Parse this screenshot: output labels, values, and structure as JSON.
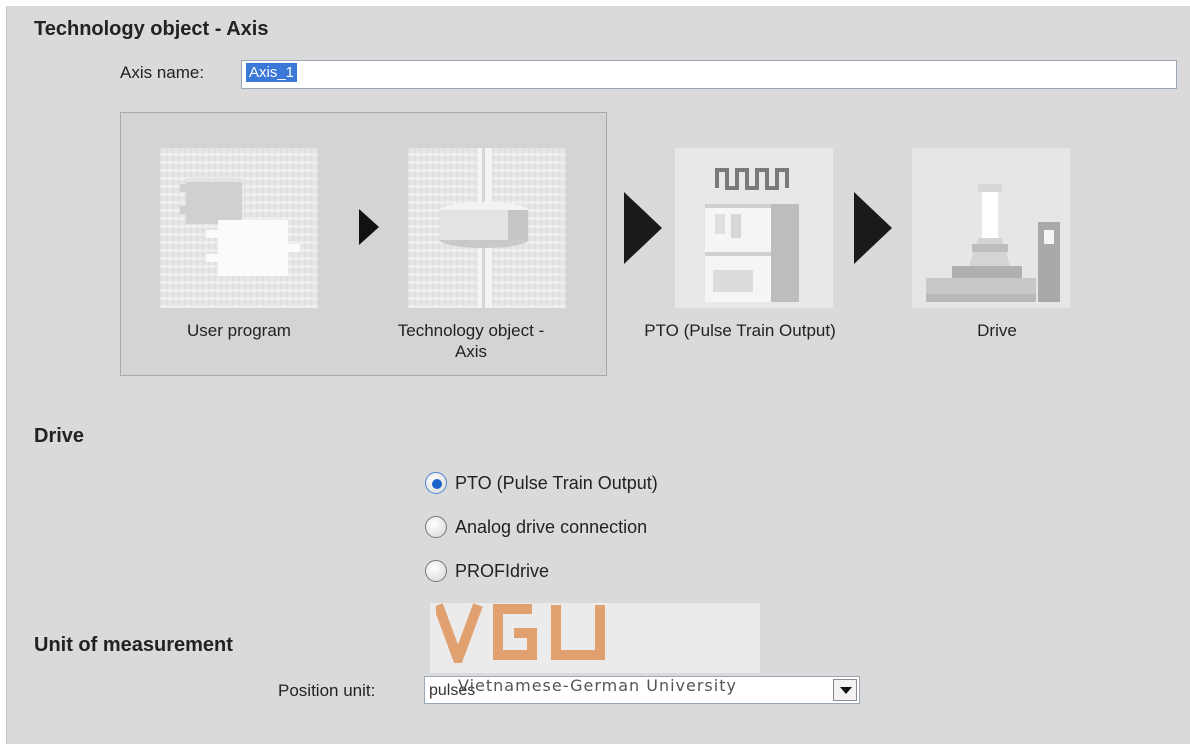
{
  "header": {
    "title": "Technology object - Axis"
  },
  "axis_name": {
    "label": "Axis name:",
    "value": "Axis_1"
  },
  "flow": {
    "user_program": "User program",
    "technology_object_line1": "Technology object -",
    "technology_object_line2": "Axis",
    "pto": "PTO (Pulse Train Output)",
    "drive": "Drive"
  },
  "drive_section": {
    "title": "Drive",
    "options": [
      {
        "label": "PTO (Pulse Train Output)",
        "checked": true
      },
      {
        "label": "Analog drive connection",
        "checked": false
      },
      {
        "label": "PROFIdrive",
        "checked": false
      }
    ]
  },
  "unit_section": {
    "title": "Unit of measurement",
    "position_unit_label": "Position unit:",
    "position_unit_value": "pulses"
  },
  "watermark": {
    "logo_text": "VGU",
    "text": "Vietnamese-German University",
    "color": "#e0a070"
  },
  "colors": {
    "accent": "#3b78d8",
    "panel": "#dadada"
  }
}
